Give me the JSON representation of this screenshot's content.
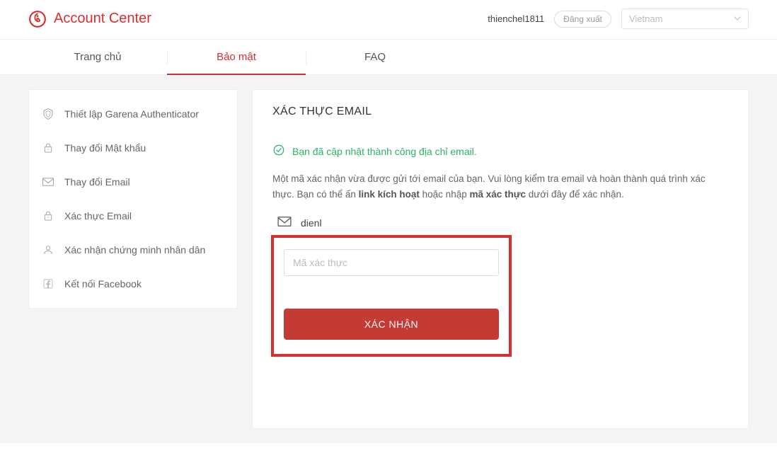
{
  "header": {
    "brand_title": "Account Center",
    "username": "thienchel1811",
    "logout_label": "Đăng xuất",
    "country": "Vietnam"
  },
  "tabs": {
    "home": "Trang chủ",
    "security": "Bảo mật",
    "faq": "FAQ"
  },
  "sidebar": {
    "items": [
      {
        "label": "Thiết lập Garena Authenticator"
      },
      {
        "label": "Thay đổi Mật khẩu"
      },
      {
        "label": "Thay đổi Email"
      },
      {
        "label": "Xác thực Email"
      },
      {
        "label": "Xác nhận chứng minh nhân dân"
      },
      {
        "label": "Kết nối Facebook"
      }
    ]
  },
  "content": {
    "title": "XÁC THỰC EMAIL",
    "success_message": "Bạn đã cập nhật thành công địa chỉ email.",
    "instruction_pre": "Một mã xác nhận vừa được gửi tới email của bạn. Vui lòng kiểm tra email và hoàn thành quá trình xác thực. Bạn có thể ấn ",
    "link_bold": "link kích hoạt",
    "instruction_mid": " hoặc nhập ",
    "code_bold": "mã xác thực",
    "instruction_end": " dưới đây để xác nhận.",
    "email_display": "dienl",
    "code_placeholder": "Mã xác thực",
    "confirm_label": "XÁC NHẬN"
  }
}
